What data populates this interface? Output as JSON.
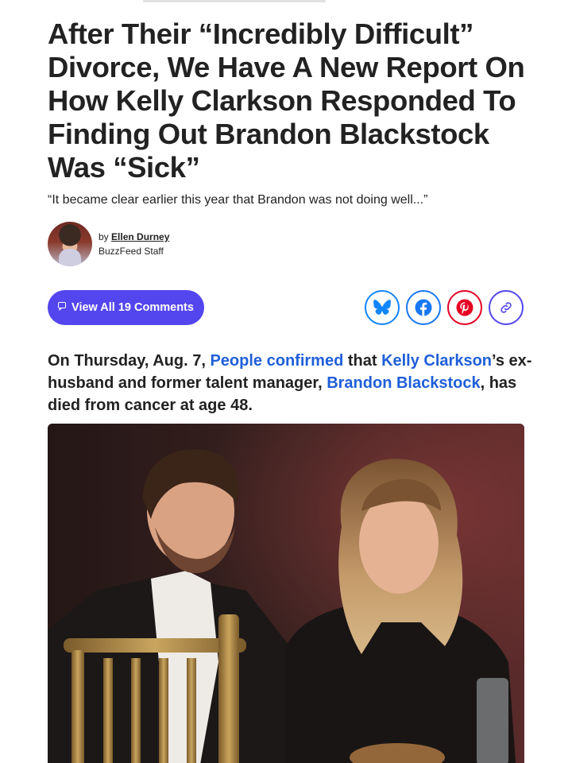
{
  "article": {
    "headline": "After Their “Incredibly Difficult” Divorce, We Have A New Report On How Kelly Clarkson Responded To Finding Out Brandon Blackstock Was “Sick”",
    "dek": "“It became clear earlier this year that Brandon was not doing well...”",
    "byline": {
      "by": "by",
      "author": "Ellen Durney",
      "role": "BuzzFeed Staff"
    },
    "comments_label": "View All 19 Comments",
    "comments_icon": "comment-icon",
    "share": [
      {
        "name": "bluesky",
        "icon": "bluesky-icon",
        "color": "#1185fe"
      },
      {
        "name": "facebook",
        "icon": "facebook-icon",
        "color": "#1877f2"
      },
      {
        "name": "pinterest",
        "icon": "pinterest-icon",
        "color": "#e60023"
      },
      {
        "name": "copy-link",
        "icon": "link-icon",
        "color": "#5346ee"
      }
    ],
    "lede": {
      "t1": "On Thursday, Aug. 7, ",
      "l1": "People confirmed",
      "t2": " that ",
      "l2": "Kelly Clarkson",
      "t3": "’s ex-husband and former talent manager, ",
      "l3": "Brandon Blackstock",
      "t4": ", has died from cancer at age 48."
    }
  },
  "colors": {
    "accent": "#5346ee",
    "link": "#1f5fd9",
    "text": "#222222"
  }
}
